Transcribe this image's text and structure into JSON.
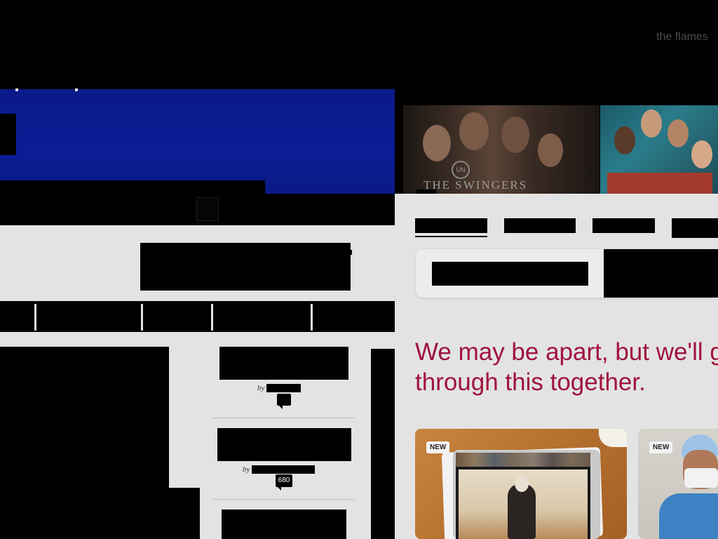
{
  "top_right": {
    "text": "the flames"
  },
  "hero": {
    "show_title": "THE SWINGERS",
    "network_mark": "UN"
  },
  "stories": [
    {
      "by_label": "by",
      "comment_count": ""
    },
    {
      "by_label": "by",
      "comment_count": "680"
    }
  ],
  "headline": {
    "line1": "We may be apart, but we'll g",
    "line2": "through this together."
  },
  "cards": [
    {
      "badge": "NEW"
    },
    {
      "badge": "NEW"
    }
  ],
  "colors": {
    "headline": "#a0123d",
    "blue_panel": "#0b1c96"
  }
}
